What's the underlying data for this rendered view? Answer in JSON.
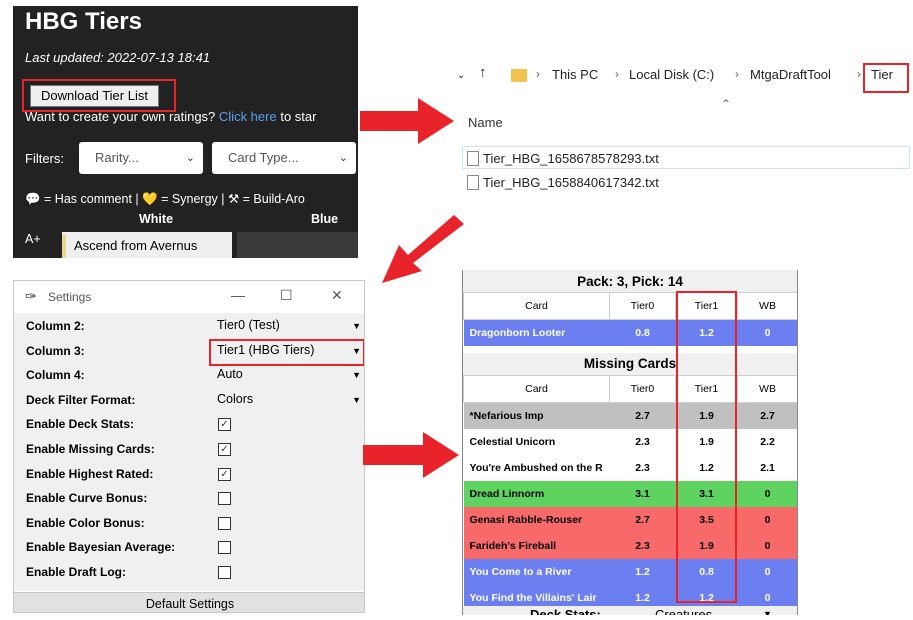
{
  "web_page": {
    "title": "HBG Tiers",
    "last_updated": "Last updated: 2022-07-13 18:41",
    "download_button": "Download Tier List",
    "create_prompt": "Want to create your own ratings?",
    "create_link": "Click here",
    "create_suffix": "to star",
    "filters_label": "Filters:",
    "rarity_select": "Rarity...",
    "card_type_select": "Card Type...",
    "legend": "💬 = Has comment | 💛 = Synergy | ⚒ = Build-Aro",
    "columns": [
      "White",
      "Blue"
    ],
    "tier_label": "A+",
    "card_name": "Ascend from Avernus"
  },
  "explorer": {
    "breadcrumbs": [
      "This PC",
      "Local Disk (C:)",
      "MtgaDraftTool",
      "Tier"
    ],
    "column_header": "Name",
    "files": [
      "Tier_HBG_1658678578293.txt",
      "Tier_HBG_1658840617342.txt"
    ]
  },
  "settings": {
    "window_title": "Settings",
    "rows": [
      {
        "label": "Column 2:",
        "value": "Tier0 (Test)",
        "type": "dropdown"
      },
      {
        "label": "Column 3:",
        "value": "Tier1 (HBG Tiers)",
        "type": "dropdown"
      },
      {
        "label": "Column 4:",
        "value": "Auto",
        "type": "dropdown"
      },
      {
        "label": "Deck Filter Format:",
        "value": "Colors",
        "type": "dropdown"
      },
      {
        "label": "Enable Deck Stats:",
        "checked": true,
        "type": "checkbox"
      },
      {
        "label": "Enable Missing Cards:",
        "checked": true,
        "type": "checkbox"
      },
      {
        "label": "Enable Highest Rated:",
        "checked": true,
        "type": "checkbox"
      },
      {
        "label": "Enable Curve Bonus:",
        "checked": false,
        "type": "checkbox"
      },
      {
        "label": "Enable Color Bonus:",
        "checked": false,
        "type": "checkbox"
      },
      {
        "label": "Enable Bayesian Average:",
        "checked": false,
        "type": "checkbox"
      },
      {
        "label": "Enable Draft Log:",
        "checked": false,
        "type": "checkbox"
      }
    ],
    "default_button": "Default Settings"
  },
  "draft_tool": {
    "pack_header": "Pack: 3, Pick: 14",
    "columns": [
      "Card",
      "Tier0",
      "Tier1",
      "WB"
    ],
    "pack_rows": [
      {
        "card": "Dragonborn Looter",
        "tier0": "0.8",
        "tier1": "1.2",
        "wb": "0",
        "color": "#6b7ff0",
        "text_color": "#ffffff"
      }
    ],
    "missing_header": "Missing Cards",
    "missing_rows": [
      {
        "card": "*Nefarious Imp",
        "tier0": "2.7",
        "tier1": "1.9",
        "wb": "2.7",
        "color": "#c0c0c0",
        "text_color": "#000000"
      },
      {
        "card": "Celestial Unicorn",
        "tier0": "2.3",
        "tier1": "1.9",
        "wb": "2.2",
        "color": "#ffffff",
        "text_color": "#000000"
      },
      {
        "card": "You're Ambushed on the R",
        "tier0": "2.3",
        "tier1": "1.2",
        "wb": "2.1",
        "color": "#ffffff",
        "text_color": "#000000"
      },
      {
        "card": "Dread Linnorm",
        "tier0": "3.1",
        "tier1": "3.1",
        "wb": "0",
        "color": "#5fd35f",
        "text_color": "#000000"
      },
      {
        "card": "Genasi Rabble-Rouser",
        "tier0": "2.7",
        "tier1": "3.5",
        "wb": "0",
        "color": "#f86a6a",
        "text_color": "#000000"
      },
      {
        "card": "Farideh's Fireball",
        "tier0": "2.3",
        "tier1": "1.9",
        "wb": "0",
        "color": "#f86a6a",
        "text_color": "#000000"
      },
      {
        "card": "You Come to a River",
        "tier0": "1.2",
        "tier1": "0.8",
        "wb": "0",
        "color": "#6b7ff0",
        "text_color": "#ffffff"
      },
      {
        "card": "You Find the Villains' Lair",
        "tier0": "1.2",
        "tier1": "1.2",
        "wb": "0",
        "color": "#6b7ff0",
        "text_color": "#ffffff"
      }
    ],
    "deck_stats_label": "Deck Stats:",
    "deck_stats_value": "Creatures"
  },
  "colors": {
    "highlight": "#e8242a",
    "arrow": "#e8242a",
    "web_bg": "#222222"
  }
}
